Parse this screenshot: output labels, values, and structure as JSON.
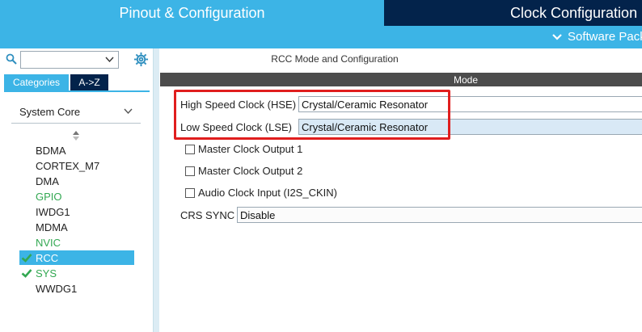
{
  "header": {
    "tabs": [
      {
        "label": "Pinout & Configuration"
      },
      {
        "label": "Clock Configuration"
      }
    ],
    "software_packs_label": "Software Packs"
  },
  "sidebar": {
    "search": {
      "value": "",
      "placeholder": ""
    },
    "tabs": [
      {
        "label": "Categories"
      },
      {
        "label": "A->Z"
      }
    ],
    "category": "System Core",
    "items": [
      {
        "label": "BDMA",
        "state": "plain"
      },
      {
        "label": "CORTEX_M7",
        "state": "plain"
      },
      {
        "label": "DMA",
        "state": "plain"
      },
      {
        "label": "GPIO",
        "state": "green"
      },
      {
        "label": "IWDG1",
        "state": "plain"
      },
      {
        "label": "MDMA",
        "state": "plain"
      },
      {
        "label": "NVIC",
        "state": "green"
      },
      {
        "label": "RCC",
        "state": "selected-checked"
      },
      {
        "label": "SYS",
        "state": "green-checked"
      },
      {
        "label": "WWDG1",
        "state": "plain"
      }
    ]
  },
  "main": {
    "title": "RCC Mode and Configuration",
    "section": "Mode",
    "hse": {
      "label": "High Speed Clock (HSE)",
      "value": "Crystal/Ceramic Resonator"
    },
    "lse": {
      "label": "Low Speed Clock (LSE)",
      "value": "Crystal/Ceramic Resonator"
    },
    "checkboxes": [
      {
        "label": "Master Clock Output 1",
        "checked": false
      },
      {
        "label": "Master Clock Output 2",
        "checked": false
      },
      {
        "label": "Audio Clock Input (I2S_CKIN)",
        "checked": false
      }
    ],
    "crs_sync": {
      "label": "CRS SYNC",
      "value": "Disable"
    }
  },
  "colors": {
    "accent": "#3cb4e6",
    "dark": "#03234b",
    "mode_bar": "#4c4c4c",
    "highlight_frame": "#e01e1e",
    "active_green": "#33a852"
  }
}
